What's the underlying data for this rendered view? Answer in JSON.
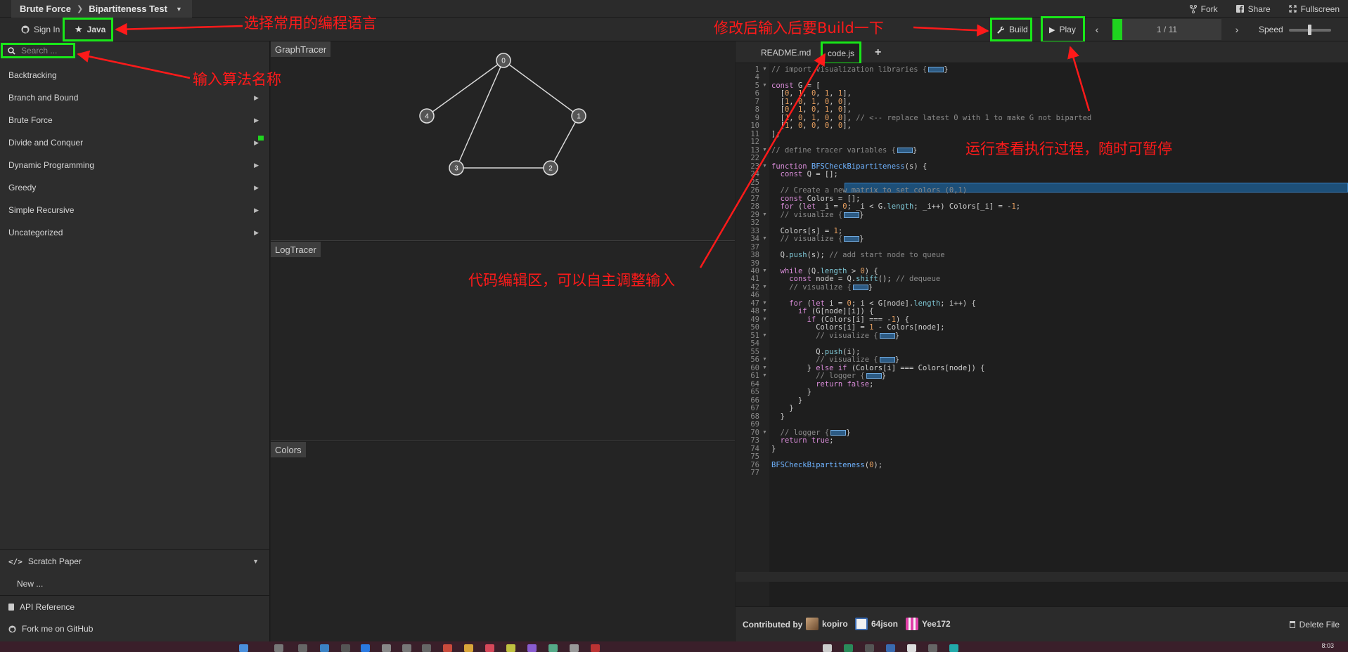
{
  "header": {
    "breadcrumb_parent": "Brute Force",
    "breadcrumb_current": "Bipartiteness Test",
    "fork": "Fork",
    "share": "Share",
    "fullscreen": "Fullscreen"
  },
  "toolbar": {
    "sign_in": "Sign In",
    "language": "Java",
    "build": "Build",
    "play": "Play",
    "progress": "1 / 11",
    "progress_fraction": 0.091,
    "speed": "Speed",
    "speed_level": 0.45
  },
  "sidebar": {
    "search_placeholder": "Search ...",
    "categories": [
      {
        "label": "Backtracking"
      },
      {
        "label": "Branch and Bound"
      },
      {
        "label": "Brute Force"
      },
      {
        "label": "Divide and Conquer"
      },
      {
        "label": "Dynamic Programming"
      },
      {
        "label": "Greedy"
      },
      {
        "label": "Simple Recursive"
      },
      {
        "label": "Uncategorized"
      }
    ],
    "scratch_paper": "Scratch Paper",
    "new_item": "New ...",
    "api_reference": "API Reference",
    "fork_github": "Fork me on GitHub"
  },
  "panes": {
    "graph": "GraphTracer",
    "log": "LogTracer",
    "colors": "Colors"
  },
  "graph": {
    "nodes": [
      "0",
      "1",
      "2",
      "3",
      "4"
    ],
    "edges": [
      [
        "0",
        "1"
      ],
      [
        "0",
        "3"
      ],
      [
        "0",
        "4"
      ],
      [
        "1",
        "2"
      ],
      [
        "2",
        "3"
      ]
    ]
  },
  "editor": {
    "tabs": [
      "README.md",
      "code.js"
    ],
    "add_tab": "+",
    "lines": [
      {
        "n": "1",
        "fold": true,
        "t": "// import visualization libraries {"
      },
      {
        "n": "4",
        "fold": false,
        "t": ""
      },
      {
        "n": "5",
        "fold": true,
        "t": "const G = ["
      },
      {
        "n": "6",
        "fold": false,
        "t": "  [0, 1, 0, 1, 1],"
      },
      {
        "n": "7",
        "fold": false,
        "t": "  [1, 0, 1, 0, 0],"
      },
      {
        "n": "8",
        "fold": false,
        "t": "  [0, 1, 0, 1, 0],"
      },
      {
        "n": "9",
        "fold": false,
        "t": "  [1, 0, 1, 0, 0], // <-- replace latest 0 with 1 to make G not biparted"
      },
      {
        "n": "10",
        "fold": false,
        "t": "  [1, 0, 0, 0, 0],"
      },
      {
        "n": "11",
        "fold": false,
        "t": "];"
      },
      {
        "n": "12",
        "fold": false,
        "t": ""
      },
      {
        "n": "13",
        "fold": true,
        "t": "// define tracer variables {"
      },
      {
        "n": "22",
        "fold": false,
        "t": ""
      },
      {
        "n": "23",
        "fold": true,
        "t": "function BFSCheckBipartiteness(s) {"
      },
      {
        "n": "24",
        "fold": false,
        "t": "  const Q = [];"
      },
      {
        "n": "25",
        "fold": false,
        "t": ""
      },
      {
        "n": "26",
        "fold": false,
        "t": "  // Create a new matrix to set colors (0,1)"
      },
      {
        "n": "27",
        "fold": false,
        "t": "  const Colors = [];"
      },
      {
        "n": "28",
        "fold": false,
        "t": "  for (let _i = 0; _i < G.length; _i++) Colors[_i] = -1;"
      },
      {
        "n": "29",
        "fold": true,
        "t": "  // visualize {"
      },
      {
        "n": "32",
        "fold": false,
        "t": ""
      },
      {
        "n": "33",
        "fold": false,
        "t": "  Colors[s] = 1;"
      },
      {
        "n": "34",
        "fold": true,
        "t": "  // visualize {"
      },
      {
        "n": "37",
        "fold": false,
        "t": ""
      },
      {
        "n": "38",
        "fold": false,
        "t": "  Q.push(s); // add start node to queue"
      },
      {
        "n": "39",
        "fold": false,
        "t": ""
      },
      {
        "n": "40",
        "fold": true,
        "t": "  while (Q.length > 0) {"
      },
      {
        "n": "41",
        "fold": false,
        "t": "    const node = Q.shift(); // dequeue"
      },
      {
        "n": "42",
        "fold": true,
        "t": "    // visualize {"
      },
      {
        "n": "46",
        "fold": false,
        "t": ""
      },
      {
        "n": "47",
        "fold": true,
        "t": "    for (let i = 0; i < G[node].length; i++) {"
      },
      {
        "n": "48",
        "fold": true,
        "t": "      if (G[node][i]) {"
      },
      {
        "n": "49",
        "fold": true,
        "t": "        if (Colors[i] === -1) {"
      },
      {
        "n": "50",
        "fold": false,
        "t": "          Colors[i] = 1 - Colors[node];"
      },
      {
        "n": "51",
        "fold": true,
        "t": "          // visualize {"
      },
      {
        "n": "54",
        "fold": false,
        "t": ""
      },
      {
        "n": "55",
        "fold": false,
        "t": "          Q.push(i);"
      },
      {
        "n": "56",
        "fold": true,
        "t": "          // visualize {"
      },
      {
        "n": "60",
        "fold": true,
        "t": "        } else if (Colors[i] === Colors[node]) {"
      },
      {
        "n": "61",
        "fold": true,
        "t": "          // logger {"
      },
      {
        "n": "64",
        "fold": false,
        "t": "          return false;"
      },
      {
        "n": "65",
        "fold": false,
        "t": "        }"
      },
      {
        "n": "66",
        "fold": false,
        "t": "      }"
      },
      {
        "n": "67",
        "fold": false,
        "t": "    }"
      },
      {
        "n": "68",
        "fold": false,
        "t": "  }"
      },
      {
        "n": "69",
        "fold": false,
        "t": ""
      },
      {
        "n": "70",
        "fold": true,
        "t": "  // logger {"
      },
      {
        "n": "73",
        "fold": false,
        "t": "  return true;"
      },
      {
        "n": "74",
        "fold": false,
        "t": "}"
      },
      {
        "n": "75",
        "fold": false,
        "t": ""
      },
      {
        "n": "76",
        "fold": false,
        "t": "BFSCheckBipartiteness(0);"
      },
      {
        "n": "77",
        "fold": false,
        "t": ""
      }
    ]
  },
  "footer": {
    "contributed_by": "Contributed by",
    "contributors": [
      "kopiro",
      "64json",
      "Yee172"
    ],
    "delete_file": "Delete File"
  },
  "annotations": {
    "language": "选择常用的编程语言",
    "build": "修改后输入后要Build一下",
    "search": "输入算法名称",
    "play": "运行查看执行过程，随时可暂停",
    "editor": "代码编辑区，可以自主调整输入"
  },
  "taskbar": {
    "clock": "8:03"
  },
  "colors": {
    "highlight_green": "#19e619",
    "annotation_red": "#ff1a1a"
  }
}
